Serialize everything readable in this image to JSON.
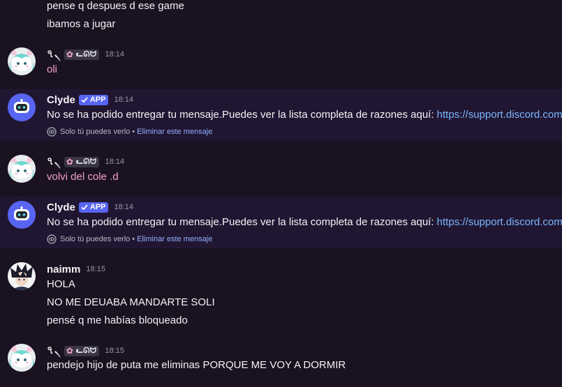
{
  "messages": [
    {
      "type": "continuation",
      "lines": [
        "pense q despues d ese game",
        "ibamos a jugar"
      ]
    },
    {
      "type": "user_pink",
      "author": "৭৲",
      "tag": "ᓚᘏᗢ",
      "time": "18:14",
      "lines": [
        "oli"
      ]
    },
    {
      "type": "clyde",
      "author": "Clyde",
      "badge": "APP",
      "time": "18:14",
      "text": "No se ha podido entregar tu mensaje.Puedes ver la lista completa de razones aquí: ",
      "link": "https://support.discord.com",
      "notice": "Solo tú puedes verlo",
      "notice_sep": "•",
      "delete_label": "Eliminar este mensaje"
    },
    {
      "type": "user_pink",
      "author": "৭৲",
      "tag": "ᓚᘏᗢ",
      "time": "18:14",
      "lines": [
        "volvi del cole .d"
      ]
    },
    {
      "type": "clyde",
      "author": "Clyde",
      "badge": "APP",
      "time": "18:14",
      "text": "No se ha podido entregar tu mensaje.Puedes ver la lista completa de razones aquí: ",
      "link": "https://support.discord.com",
      "notice": "Solo tú puedes verlo",
      "notice_sep": "•",
      "delete_label": "Eliminar este mensaje"
    },
    {
      "type": "naimm",
      "author": "naimm",
      "time": "18:15",
      "lines": [
        "HOLA",
        "NO ME DEUABA MANDARTE SOLI",
        "pensé q me habías bloqueado"
      ]
    },
    {
      "type": "user_pink",
      "author": "৭৲",
      "tag": "ᓚᘏᗢ",
      "time": "18:15",
      "lines": [
        "pendejo hijo de puta me eliminas PORQUE ME VOY A DORMIR"
      ]
    }
  ],
  "colors": {
    "background": "#1a1221",
    "ephemeral_background": "#211632",
    "pink_text": "#f0a3c4",
    "link": "#7ab7ff",
    "app_badge": "#5865f2"
  },
  "icons": {
    "check": "check-icon",
    "eye": "eye-icon",
    "flower": "flower-icon"
  }
}
